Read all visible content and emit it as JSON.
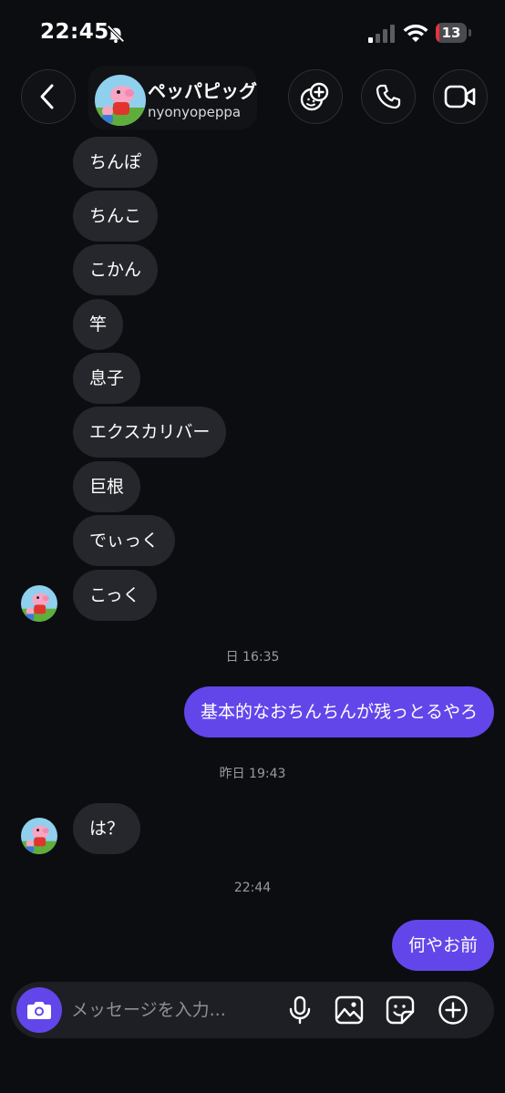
{
  "status_bar": {
    "time": "22:45",
    "battery_level": "13",
    "battery_color": "#e5323f",
    "icons": [
      "bell-muted-icon",
      "signal-icon",
      "wifi-icon",
      "battery-icon"
    ]
  },
  "header": {
    "name": "ペッパピッグ",
    "username": "nyonyopeppa",
    "buttons": [
      "back-icon",
      "sticker-add-icon",
      "phone-icon",
      "video-icon"
    ]
  },
  "messages": [
    {
      "side": "in",
      "text": "ちんぽ"
    },
    {
      "side": "in",
      "text": "ちんこ"
    },
    {
      "side": "in",
      "text": "こかん"
    },
    {
      "side": "in",
      "text": "竿"
    },
    {
      "side": "in",
      "text": "息子"
    },
    {
      "side": "in",
      "text": "エクスカリバー"
    },
    {
      "side": "in",
      "text": "巨根"
    },
    {
      "side": "in",
      "text": "でぃっく"
    },
    {
      "side": "in",
      "text": "こっく"
    },
    {
      "side": "out",
      "text": "基本的なおちんちんが残っとるやろ"
    },
    {
      "side": "in",
      "text": "は？"
    },
    {
      "side": "out",
      "text": "何やお前"
    }
  ],
  "timestamps": [
    "日 16:35",
    "昨日 19:43",
    "22:44"
  ],
  "composer": {
    "placeholder": "メッセージを入力...",
    "icons": [
      "camera-icon",
      "microphone-icon",
      "image-icon",
      "sticker-icon",
      "plus-icon"
    ]
  },
  "colors": {
    "background": "#0c0d10",
    "incoming_bubble": "#26272c",
    "outgoing_bubble": "#6246ea",
    "timestamp": "#9a9ba1"
  }
}
